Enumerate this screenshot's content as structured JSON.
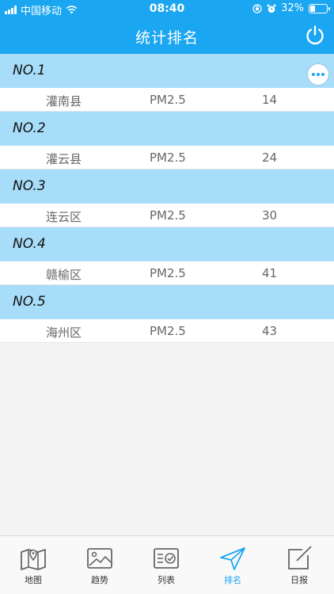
{
  "status_bar": {
    "carrier": "中国移动",
    "time": "08:40",
    "battery": "32%",
    "battery_level": 0.32
  },
  "header": {
    "title": "统计排名"
  },
  "rankings": [
    {
      "rank": "NO.1",
      "name": "灌南县",
      "pollutant": "PM2.5",
      "value": "14"
    },
    {
      "rank": "NO.2",
      "name": "灌云县",
      "pollutant": "PM2.5",
      "value": "24"
    },
    {
      "rank": "NO.3",
      "name": "连云区",
      "pollutant": "PM2.5",
      "value": "30"
    },
    {
      "rank": "NO.4",
      "name": "赣榆区",
      "pollutant": "PM2.5",
      "value": "41"
    },
    {
      "rank": "NO.5",
      "name": "海州区",
      "pollutant": "PM2.5",
      "value": "43"
    }
  ],
  "tabs": [
    {
      "label": "地图",
      "icon": "map-icon"
    },
    {
      "label": "趋势",
      "icon": "image-icon"
    },
    {
      "label": "列表",
      "icon": "list-check-icon"
    },
    {
      "label": "排名",
      "icon": "send-icon"
    },
    {
      "label": "日报",
      "icon": "edit-icon"
    }
  ],
  "colors": {
    "primary": "#1aa6f0",
    "header_row": "#a8ddfa",
    "background": "#f4f4f4"
  }
}
